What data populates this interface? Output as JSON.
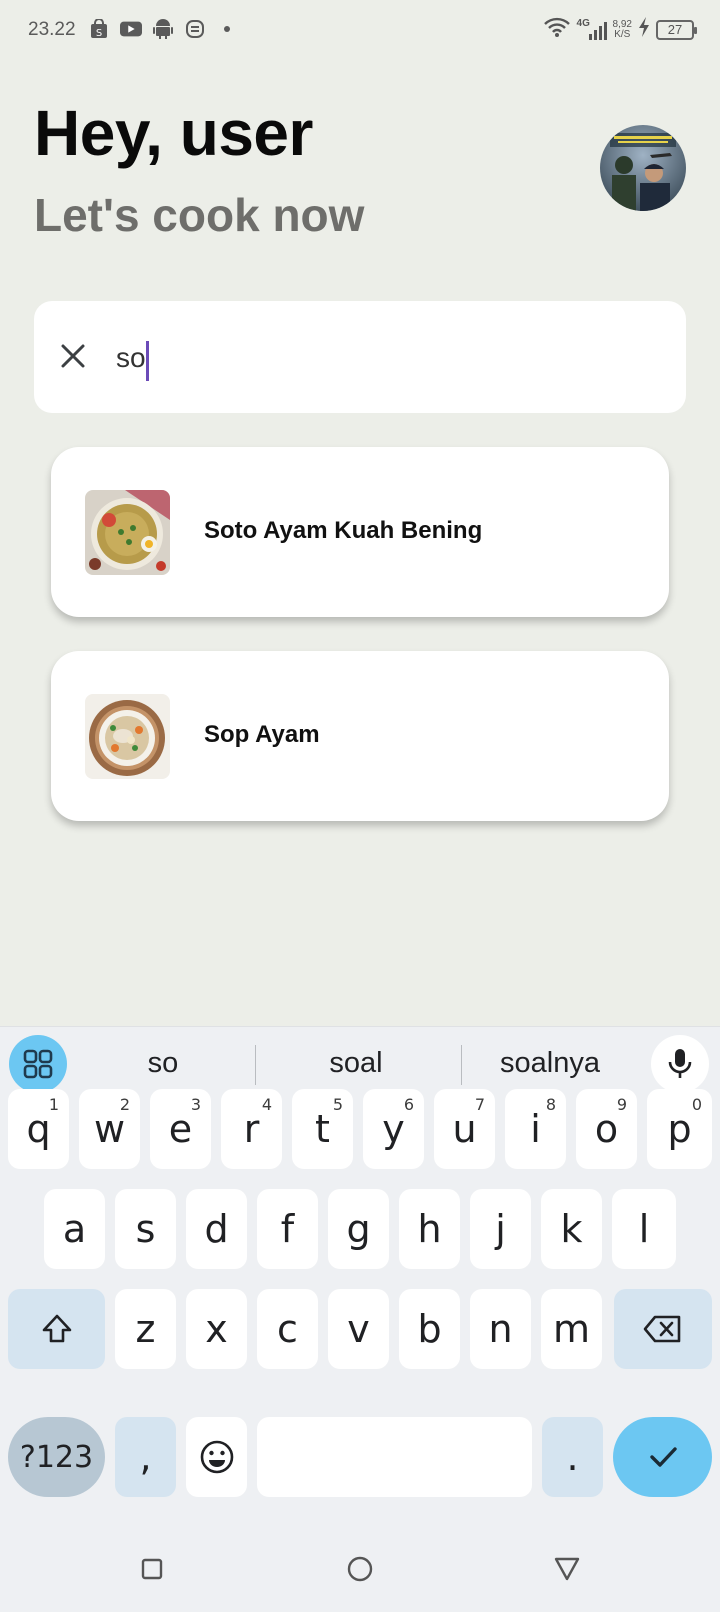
{
  "status_bar": {
    "time": "23.22",
    "net_speed_value": "8,92",
    "net_speed_unit": "K/S",
    "network_type": "4G",
    "battery_level": "27"
  },
  "header": {
    "greeting": "Hey, user",
    "subtitle": "Let's cook now"
  },
  "search": {
    "value": "so"
  },
  "results": [
    {
      "title": "Soto Ayam Kuah Bening"
    },
    {
      "title": "Sop Ayam"
    }
  ],
  "keyboard": {
    "suggestions": [
      "so",
      "soal",
      "soalnya"
    ],
    "row1": [
      {
        "key": "q",
        "hint": "1"
      },
      {
        "key": "w",
        "hint": "2"
      },
      {
        "key": "e",
        "hint": "3"
      },
      {
        "key": "r",
        "hint": "4"
      },
      {
        "key": "t",
        "hint": "5"
      },
      {
        "key": "y",
        "hint": "6"
      },
      {
        "key": "u",
        "hint": "7"
      },
      {
        "key": "i",
        "hint": "8"
      },
      {
        "key": "o",
        "hint": "9"
      },
      {
        "key": "p",
        "hint": "0"
      }
    ],
    "row2": [
      "a",
      "s",
      "d",
      "f",
      "g",
      "h",
      "j",
      "k",
      "l"
    ],
    "row3": [
      "z",
      "x",
      "c",
      "v",
      "b",
      "n",
      "m"
    ],
    "symbols_label": "?123",
    "comma": ",",
    "period": "."
  }
}
